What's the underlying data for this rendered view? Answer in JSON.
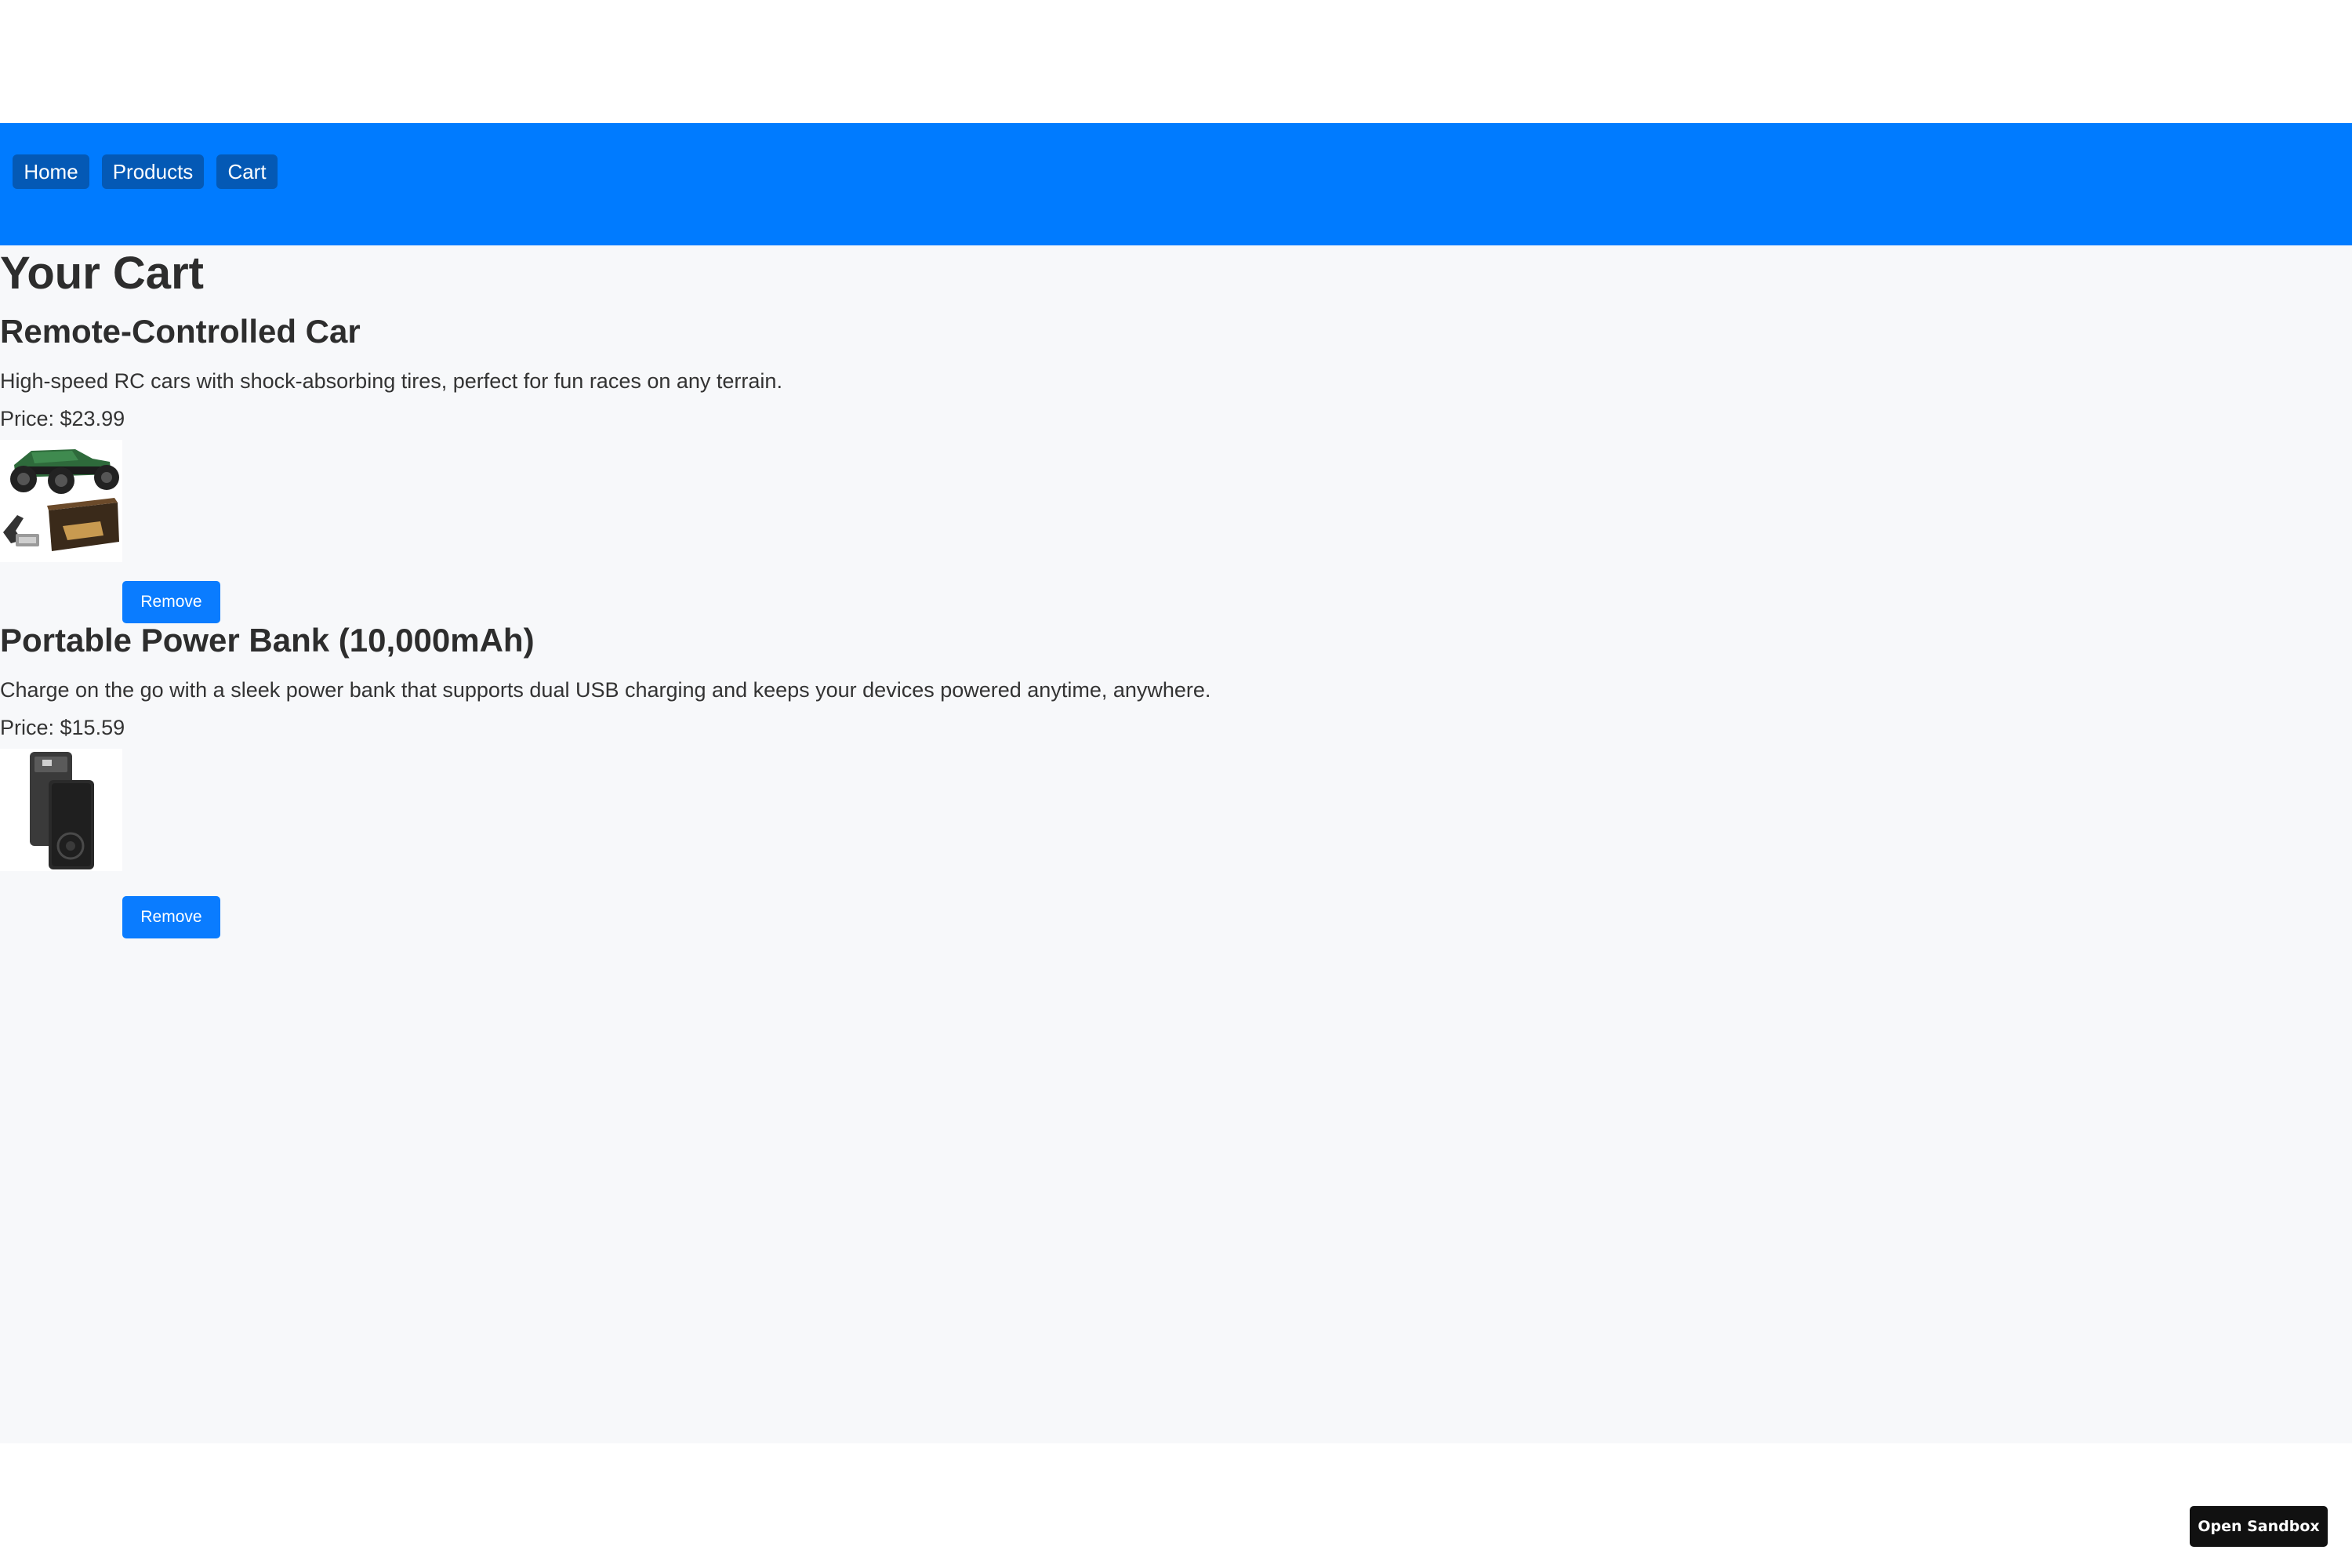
{
  "nav": {
    "items": [
      {
        "label": "Home"
      },
      {
        "label": "Products"
      },
      {
        "label": "Cart"
      }
    ]
  },
  "page": {
    "title": "Your Cart"
  },
  "cart": {
    "items": [
      {
        "name": "Remote-Controlled Car",
        "description": "High-speed RC cars with shock-absorbing tires, perfect for fun races on any terrain.",
        "price": "Price: $23.99",
        "image_icon": "rc-car-icon",
        "remove_label": "Remove"
      },
      {
        "name": "Portable Power Bank (10,000mAh)",
        "description": "Charge on the go with a sleek power bank that supports dual USB charging and keeps your devices powered anytime, anywhere.",
        "price": "Price: $15.59",
        "image_icon": "power-bank-icon",
        "remove_label": "Remove"
      }
    ]
  },
  "sandbox": {
    "label": "Open Sandbox"
  },
  "colors": {
    "navbar": "#007bff",
    "nav_button": "#0459b5",
    "remove_button": "#0a7cff",
    "page_background": "#f7f8fa",
    "sandbox_button": "#111111"
  }
}
